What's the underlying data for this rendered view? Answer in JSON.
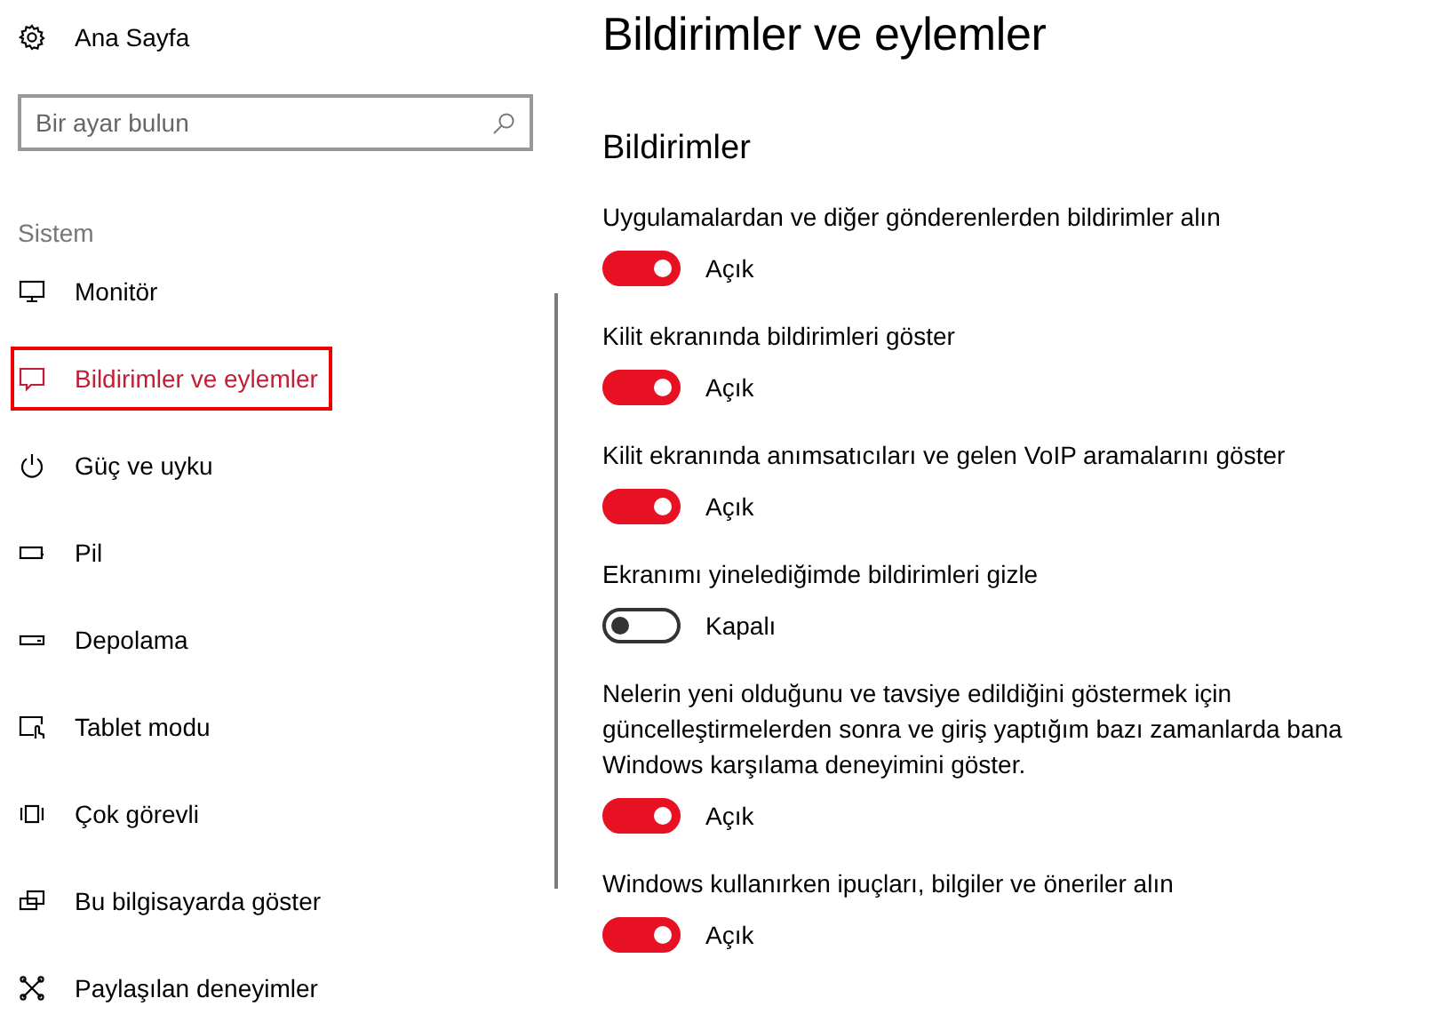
{
  "sidebar": {
    "home": "Ana Sayfa",
    "search": {
      "placeholder": "Bir ayar bulun"
    },
    "section": "Sistem",
    "items": [
      {
        "label": "Monitör",
        "selected": false
      },
      {
        "label": "Bildirimler ve eylemler",
        "selected": true
      },
      {
        "label": "Güç ve uyku",
        "selected": false
      },
      {
        "label": "Pil",
        "selected": false
      },
      {
        "label": "Depolama",
        "selected": false
      },
      {
        "label": "Tablet modu",
        "selected": false
      },
      {
        "label": "Çok görevli",
        "selected": false
      },
      {
        "label": "Bu bilgisayarda göster",
        "selected": false
      },
      {
        "label": "Paylaşılan deneyimler",
        "selected": false
      }
    ]
  },
  "page": {
    "title": "Bildirimler ve eylemler",
    "section": "Bildirimler",
    "settings": [
      {
        "label": "Uygulamalardan ve diğer gönderenlerden bildirimler alın",
        "on": true,
        "state": "Açık"
      },
      {
        "label": "Kilit ekranında bildirimleri göster",
        "on": true,
        "state": "Açık"
      },
      {
        "label": "Kilit ekranında anımsatıcıları ve gelen VoIP aramalarını göster",
        "on": true,
        "state": "Açık"
      },
      {
        "label": "Ekranımı yinelediğimde bildirimleri gizle",
        "on": false,
        "state": "Kapalı"
      },
      {
        "label": "Nelerin yeni olduğunu ve tavsiye edildiğini göstermek için güncelleştirmelerden sonra ve giriş yaptığım bazı zamanlarda bana Windows karşılama deneyimini göster.",
        "on": true,
        "state": "Açık"
      },
      {
        "label": "Windows kullanırken ipuçları, bilgiler ve öneriler alın",
        "on": true,
        "state": "Açık"
      }
    ]
  }
}
